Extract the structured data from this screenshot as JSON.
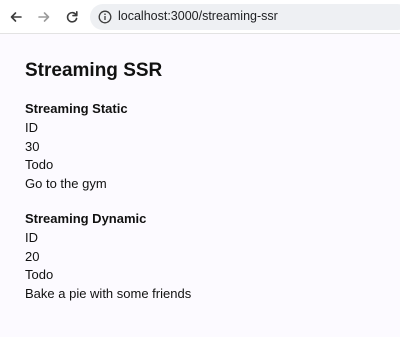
{
  "browser": {
    "url": "localhost:3000/streaming-ssr"
  },
  "page": {
    "title": "Streaming SSR",
    "sections": [
      {
        "heading": "Streaming Static",
        "id_label": "ID",
        "id_value": "30",
        "todo_label": "Todo",
        "todo_value": "Go to the gym"
      },
      {
        "heading": "Streaming Dynamic",
        "id_label": "ID",
        "id_value": "20",
        "todo_label": "Todo",
        "todo_value": "Bake a pie with some friends"
      }
    ]
  }
}
